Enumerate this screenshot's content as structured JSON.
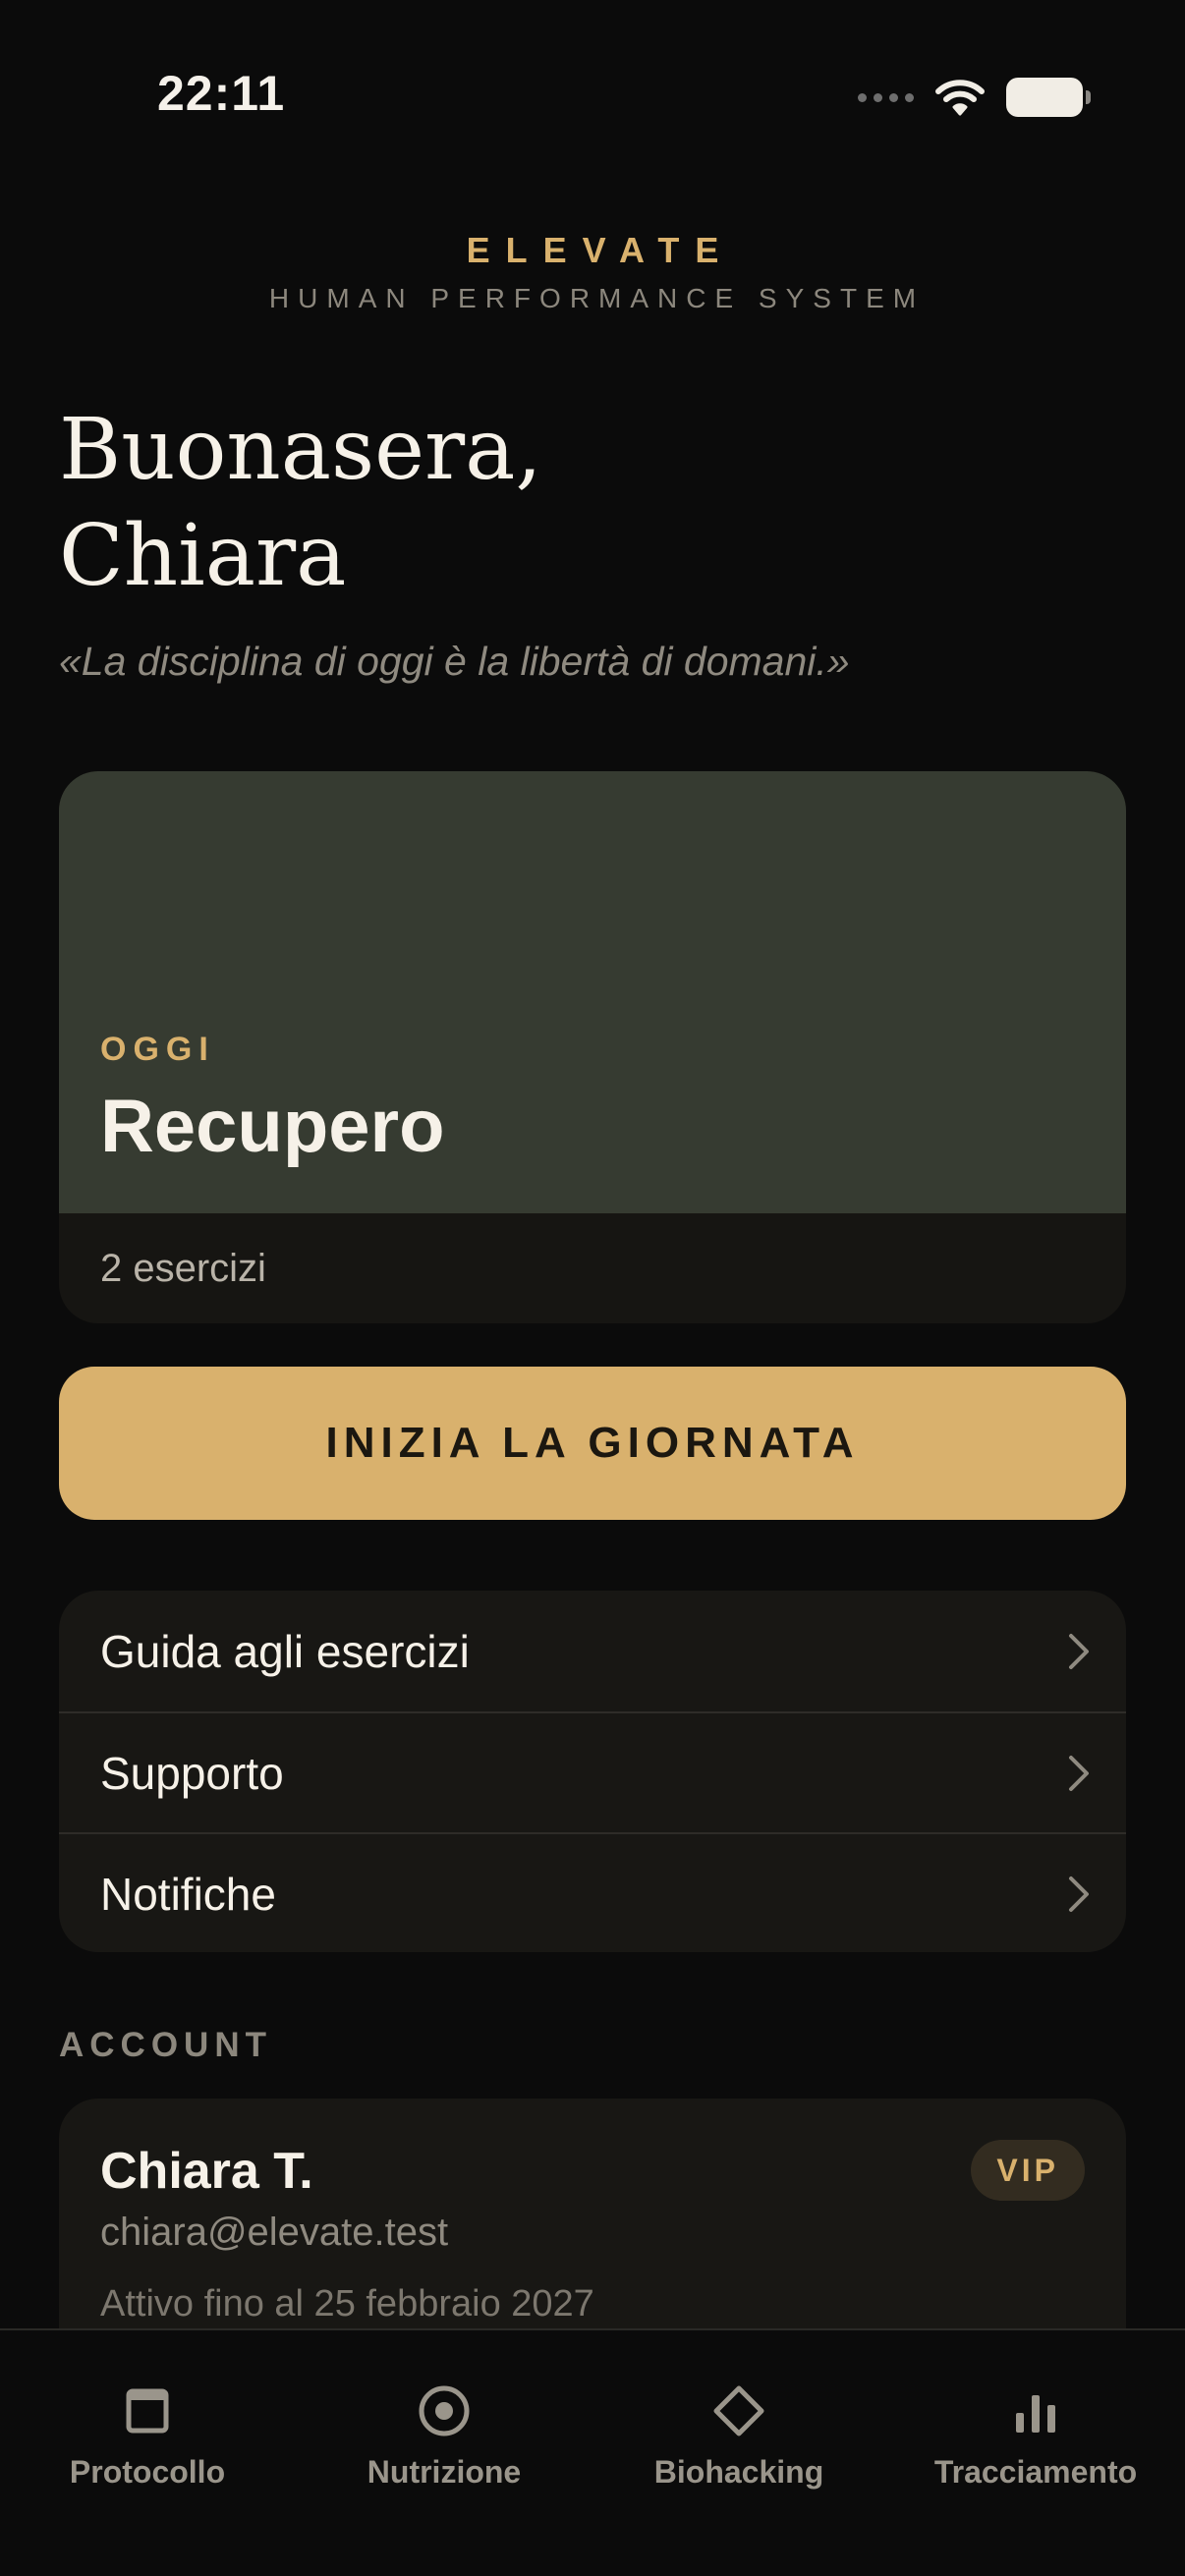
{
  "status_bar": {
    "time": "22:11"
  },
  "brand": {
    "title": "ELEVATE",
    "subtitle": "HUMAN PERFORMANCE SYSTEM"
  },
  "greeting": {
    "line1": "Buonasera,",
    "line2": "Chiara"
  },
  "quote": "«La disciplina di oggi è la libertà di domani.»",
  "today": {
    "eyebrow": "OGGI",
    "title": "Recupero",
    "meta": "2 esercizi"
  },
  "cta": {
    "label": "INIZIA LA GIORNATA"
  },
  "menu": {
    "items": [
      {
        "label": "Guida agli esercizi",
        "icon": "chevron-right-icon"
      },
      {
        "label": "Supporto",
        "icon": "chevron-right-icon"
      },
      {
        "label": "Notifiche",
        "icon": "chevron-right-icon"
      }
    ]
  },
  "account": {
    "section_label": "ACCOUNT",
    "name": "Chiara T.",
    "email": "chiara@elevate.test",
    "expiry": "Attivo fino al 25 febbraio 2027",
    "badge": "VIP"
  },
  "tabs": [
    {
      "label": "Protocollo",
      "icon": "calendar-icon"
    },
    {
      "label": "Nutrizione",
      "icon": "target-icon"
    },
    {
      "label": "Biohacking",
      "icon": "diamond-icon"
    },
    {
      "label": "Tracciamento",
      "icon": "bar-chart-icon"
    }
  ],
  "colors": {
    "background": "#0b0b0b",
    "accent_gold": "#d9b16d",
    "card_dark": "#181714",
    "card_green": "#363b31",
    "text_primary": "#f6f1e8",
    "text_muted": "#8f8a80"
  }
}
